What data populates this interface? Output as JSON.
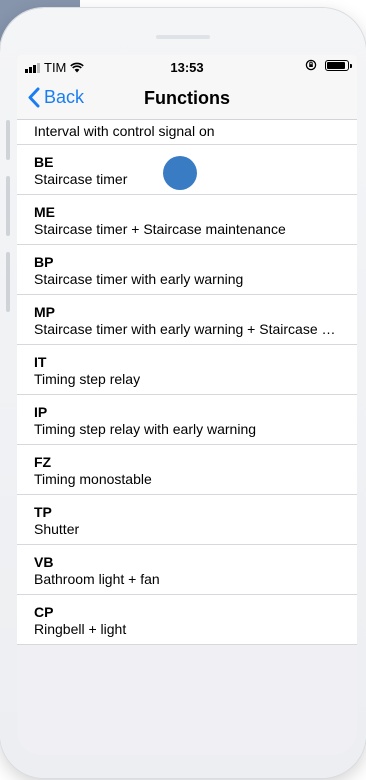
{
  "status_bar": {
    "carrier": "TIM",
    "time": "13:53",
    "battery_level": 0.9
  },
  "nav": {
    "back_label": "Back",
    "title": "Functions"
  },
  "functions": {
    "partial_item": "Interval with control signal on",
    "items": [
      {
        "code": "BE",
        "desc": "Staircase timer"
      },
      {
        "code": "ME",
        "desc": "Staircase timer + Staircase maintenance"
      },
      {
        "code": "BP",
        "desc": "Staircase timer with early warning"
      },
      {
        "code": "MP",
        "desc": "Staircase timer with early warning + Staircase maintenance"
      },
      {
        "code": "IT",
        "desc": "Timing step relay"
      },
      {
        "code": "IP",
        "desc": "Timing step relay with early warning"
      },
      {
        "code": "FZ",
        "desc": "Timing monostable"
      },
      {
        "code": "TP",
        "desc": "Shutter"
      },
      {
        "code": "VB",
        "desc": "Bathroom light + fan"
      },
      {
        "code": "CP",
        "desc": "Ringbell + light"
      }
    ]
  },
  "colors": {
    "accent": "#1a7ef2",
    "touch_indicator": "#3a7cc4"
  }
}
